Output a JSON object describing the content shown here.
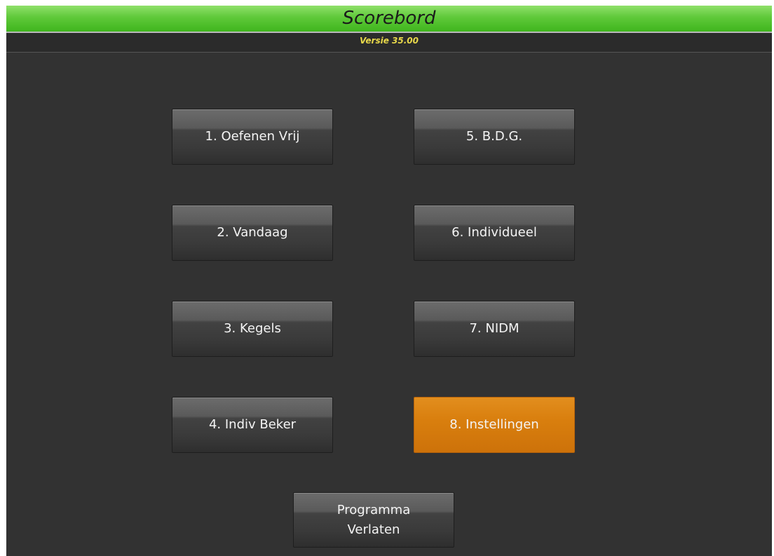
{
  "app": {
    "title": "Scorebord",
    "version": "Versie 35.00",
    "accent_green": "#5fc93a",
    "active_orange": "#d97f0e"
  },
  "menu": {
    "buttons": [
      {
        "label": "1. Oefenen Vrij"
      },
      {
        "label": "2. Vandaag"
      },
      {
        "label": "3. Kegels"
      },
      {
        "label": "4. Indiv Beker"
      },
      {
        "label": "5. B.D.G."
      },
      {
        "label": "6. Individueel"
      },
      {
        "label": "7. NIDM"
      },
      {
        "label": "8. Instellingen",
        "active": true
      }
    ],
    "exit_label": "Programma\nVerlaten"
  }
}
